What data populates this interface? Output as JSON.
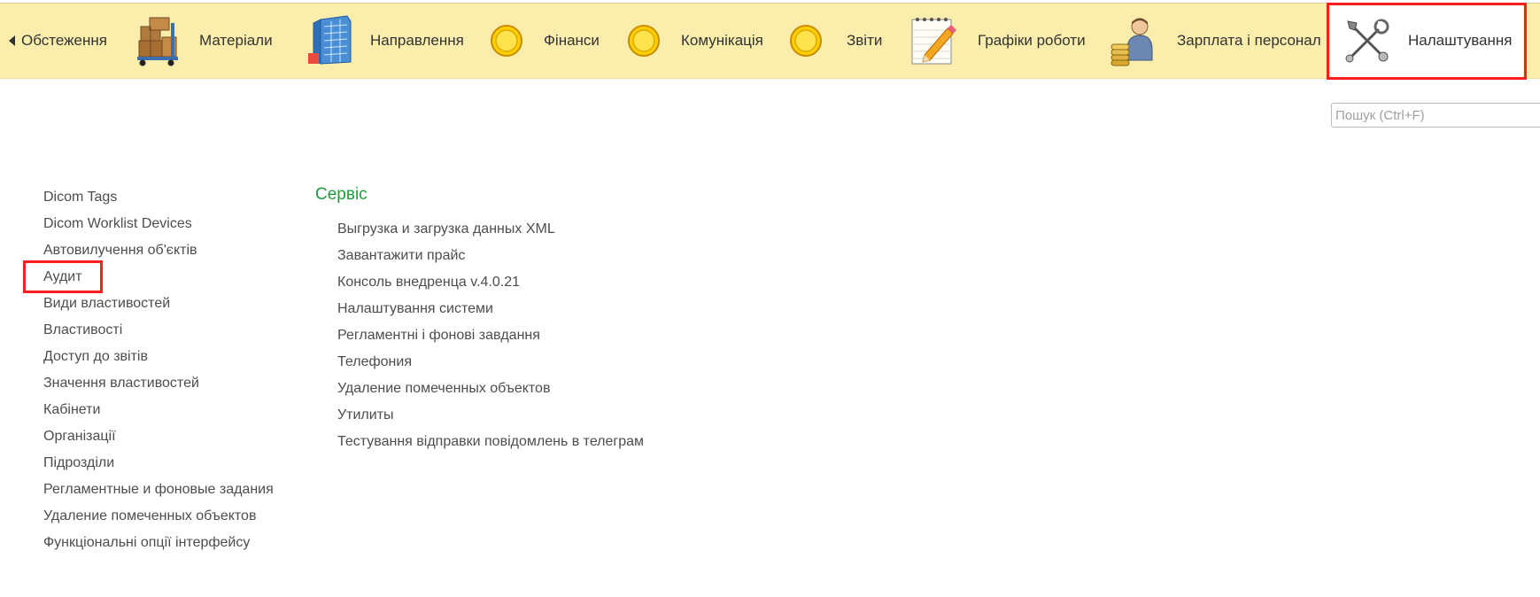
{
  "sections": {
    "items": [
      {
        "label": "Обстеження",
        "icon": "clipboard-icon"
      },
      {
        "label": "Матеріали",
        "icon": "boxes-cart-icon"
      },
      {
        "label": "Направлення",
        "icon": "building-icon"
      },
      {
        "label": "Фінанси",
        "icon": "yellow-circle-icon"
      },
      {
        "label": "Комунікація",
        "icon": "yellow-circle-icon"
      },
      {
        "label": "Звіти",
        "icon": "yellow-circle-icon"
      },
      {
        "label": "Графіки роботи",
        "icon": "notepad-pencil-icon"
      },
      {
        "label": "Зарплата і персонал",
        "icon": "worker-coins-icon"
      },
      {
        "label": "Налаштування",
        "icon": "tools-icon"
      }
    ],
    "active": "Налаштування"
  },
  "search": {
    "placeholder": "Пошук (Ctrl+F)",
    "value": ""
  },
  "left_list": {
    "items": [
      "Dicom Tags",
      "Dicom Worklist Devices",
      "Автовилучення об'єктів",
      "Аудит",
      "Види властивостей",
      "Властивості",
      "Доступ до звітів",
      "Значення властивостей",
      "Кабінети",
      "Організації",
      "Підрозділи",
      "Регламентные и фоновые задания",
      "Удаление помеченных объектов",
      "Функціональні опції інтерфейсу"
    ],
    "highlighted": "Аудит"
  },
  "service": {
    "title": "Сервіс",
    "items": [
      "Выгрузка и загрузка данных XML",
      "Завантажити прайс",
      "Консоль внедренца v.4.0.21",
      "Налаштування системи",
      "Регламентні і фонові завдання",
      "Телефония",
      "Удаление помеченных объектов",
      "Утилиты",
      "Тестування відправки повідомлень в телеграм"
    ]
  },
  "colors": {
    "panel_bg": "#fbedac",
    "highlight": "#ff1c1c",
    "group_title": "#1e9e3a",
    "text": "#4d4d4d"
  }
}
